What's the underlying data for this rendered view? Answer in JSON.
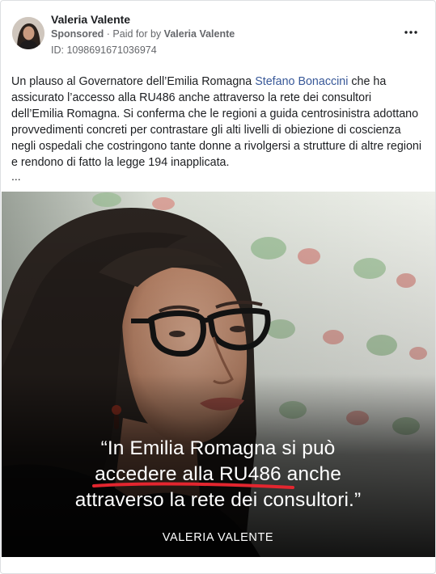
{
  "ad": {
    "page_name": "Valeria Valente",
    "sponsored_label": "Sponsored",
    "paid_for_prefix": "Paid for by",
    "payer": "Valeria Valente",
    "id_label": "ID: 1098691671036974",
    "more_options_glyph": "•••"
  },
  "post": {
    "text_before_mention": "Un plauso al Governatore dell’Emilia Romagna ",
    "mention": "Stefano Bonaccini",
    "text_after_mention": " che ha assicurato l’accesso alla RU486 anche attraverso la rete dei consultori dell’Emilia Romagna. Si conferma che le regioni a guida centrosinistra adottano provvedimenti concreti per contrastare gli alti livelli di obiezione di coscienza negli ospedali che costringono tante donne a rivolgersi a strutture di altre regioni e rendono di fatto la legge 194 inapplicata.",
    "see_more": "..."
  },
  "image": {
    "quote_line1": "“In Emilia Romagna si può",
    "quote_line2_highlight": "accedere alla RU486",
    "quote_line2_rest": " anche",
    "quote_line3": "attraverso la rete dei consultori.”",
    "author": "VALERIA VALENTE"
  },
  "colors": {
    "mention_link": "#385898",
    "secondary_text": "#65676b",
    "highlight_underline": "#e3262f"
  },
  "icons": {
    "avatar": "profile-photo",
    "more_options": "three-dots-icon"
  }
}
